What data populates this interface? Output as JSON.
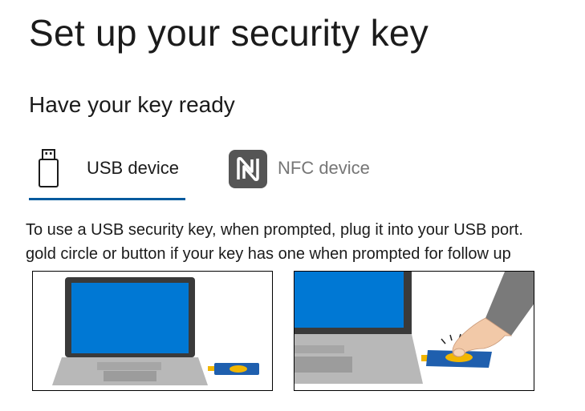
{
  "header": {
    "title": "Set up your security key",
    "subtitle": "Have your key ready"
  },
  "tabs": [
    {
      "label": "USB device",
      "icon": "usb-key-icon",
      "selected": true
    },
    {
      "label": "NFC device",
      "icon": "nfc-icon",
      "selected": false
    }
  ],
  "instructions": {
    "line1": "To use a USB security key, when prompted, plug it into your USB port. ",
    "line2": "gold circle or button if your key has one when prompted for follow up"
  },
  "illustrations": [
    {
      "name": "usb-key-plugged-into-laptop-illustration"
    },
    {
      "name": "touch-gold-button-illustration"
    }
  ],
  "colors": {
    "accent": "#005a9e",
    "screen_blue": "#0078d4",
    "laptop_gray": "#b8b8b8",
    "key_gold": "#f2b600",
    "key_blue": "#1f5fae"
  }
}
